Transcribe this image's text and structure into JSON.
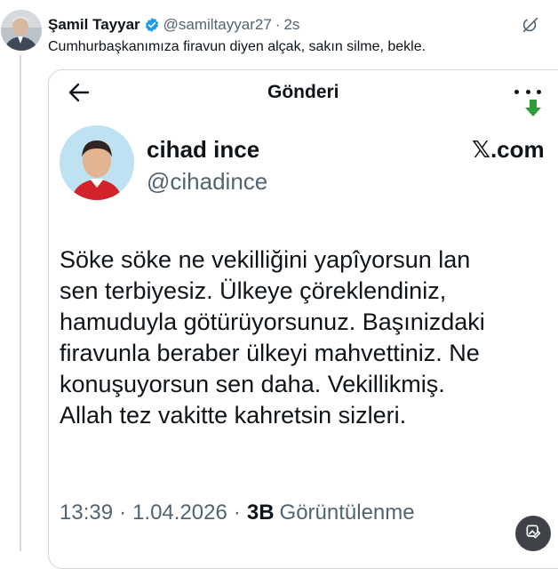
{
  "tweet": {
    "author_name": "Şamil Tayyar",
    "author_handle": "@samiltayyar27",
    "separator": "·",
    "time": "2s",
    "text": "Cumhurbaşkanımıza firavun diyen alçak, sakın silme, bekle."
  },
  "media": {
    "title": "Gönderi",
    "account_name": "cihad ince",
    "account_handle": "@cihadince",
    "domain": "𝕏.com",
    "body_lines": [
      "Söke söke ne vekilliğini yapîyorsun lan",
      "sen terbiyesiz. Ülkeye çöreklendiniz,",
      "hamuduyla götürüyorsunuz. Başınizdaki",
      "firavunla beraber  ülkeyi mahvettiniz. Ne",
      "konuşuyorsun sen daha. Vekillikmiş.",
      "Allah tez vakitte kahretsin sizleri."
    ],
    "time": "13:39",
    "separator": "·",
    "date": "1.04.2026",
    "views_count": "3B",
    "views_label": "Görüntülenme"
  },
  "icons": {
    "verified": "verified-badge-icon",
    "share": "grok-share-icon",
    "back": "back-arrow-icon",
    "more": "more-dots-icon",
    "download": "green-down-arrow-icon",
    "alt_edit": "image-edit-icon"
  },
  "colors": {
    "verified": "#1d9bf0",
    "secondary_text": "#536471",
    "download_arrow": "#2e9d3a"
  }
}
